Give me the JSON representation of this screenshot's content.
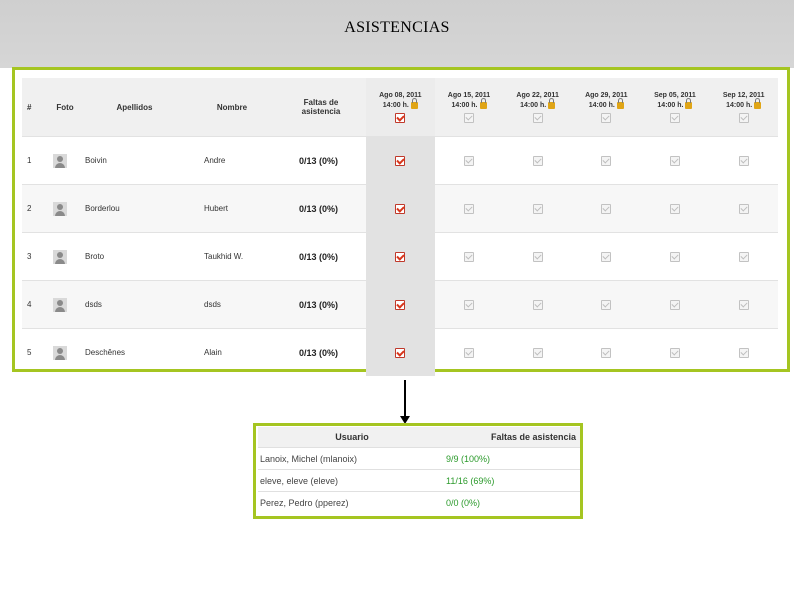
{
  "page": {
    "title": "ASISTENCIAS"
  },
  "attendance": {
    "headers": {
      "num": "#",
      "photo": "Foto",
      "apellidos": "Apellidos",
      "nombre": "Nombre",
      "faltas_l1": "Faltas de",
      "faltas_l2": "asistencia"
    },
    "sessions": [
      {
        "date": "Ago 08, 2011",
        "time": "14:00 h."
      },
      {
        "date": "Ago 15, 2011",
        "time": "14:00 h."
      },
      {
        "date": "Ago 22, 2011",
        "time": "14:00 h."
      },
      {
        "date": "Ago 29, 2011",
        "time": "14:00 h."
      },
      {
        "date": "Sep 05, 2011",
        "time": "14:00 h."
      },
      {
        "date": "Sep 12, 2011",
        "time": "14:00 h."
      }
    ],
    "rows": [
      {
        "num": "1",
        "apellidos": "Boivin",
        "nombre": "Andre",
        "faltas": "0/13 (0%)"
      },
      {
        "num": "2",
        "apellidos": "Borderlou",
        "nombre": "Hubert",
        "faltas": "0/13 (0%)"
      },
      {
        "num": "3",
        "apellidos": "Broto",
        "nombre": "Taukhid W.",
        "faltas": "0/13 (0%)"
      },
      {
        "num": "4",
        "apellidos": "dsds",
        "nombre": "dsds",
        "faltas": "0/13 (0%)"
      },
      {
        "num": "5",
        "apellidos": "Deschênes",
        "nombre": "Alain",
        "faltas": "0/13 (0%)"
      }
    ],
    "colors": {
      "frame": "#a5c521",
      "check": "#d9361b",
      "lock": "#e0a516"
    }
  },
  "summary": {
    "headers": {
      "usuario": "Usuario",
      "faltas": "Faltas de asistencia"
    },
    "rows": [
      {
        "usuario": "Lanoix, Michel (mlanoix)",
        "faltas": "9/9 (100%)"
      },
      {
        "usuario": "eleve, eleve (eleve)",
        "faltas": "11/16 (69%)"
      },
      {
        "usuario": "Perez, Pedro (pperez)",
        "faltas": "0/0 (0%)"
      }
    ],
    "colors": {
      "value": "#2b9a2b"
    }
  }
}
